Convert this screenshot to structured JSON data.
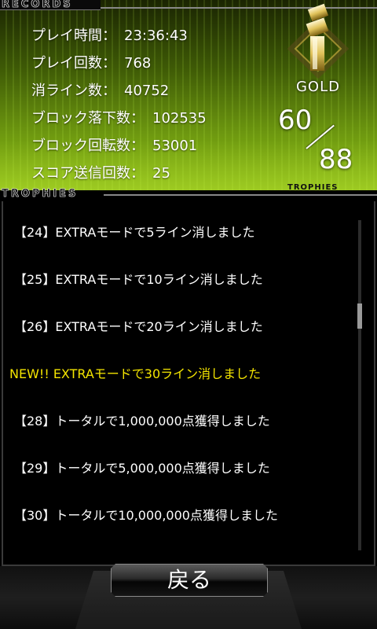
{
  "records": {
    "section_title": "RECORDS",
    "stats": [
      {
        "label": "プレイ時間：",
        "value": "23:36:43"
      },
      {
        "label": "プレイ回数：",
        "value": "768"
      },
      {
        "label": "消ライン数：",
        "value": "40752"
      },
      {
        "label": "ブロック落下数：",
        "value": "102535"
      },
      {
        "label": "ブロック回転数：",
        "value": "53001"
      },
      {
        "label": "スコア送信回数：",
        "value": "25"
      }
    ]
  },
  "rank": {
    "label": "GOLD",
    "badge_icon": "gold-rank-emblem-icon",
    "trophies_earned": "60",
    "trophies_total": "88",
    "caption": "TROPHIES"
  },
  "trophies": {
    "section_title": "TROPHIES",
    "items": [
      {
        "text": "【24】EXTRAモードで5ライン消しました",
        "is_new": false
      },
      {
        "text": "【25】EXTRAモードで10ライン消しました",
        "is_new": false
      },
      {
        "text": "【26】EXTRAモードで20ライン消しました",
        "is_new": false
      },
      {
        "text": "NEW!! EXTRAモードで30ライン消しました",
        "is_new": true
      },
      {
        "text": "【28】トータルで1,000,000点獲得しました",
        "is_new": false
      },
      {
        "text": "【29】トータルで5,000,000点獲得しました",
        "is_new": false
      },
      {
        "text": "【30】トータルで10,000,000点獲得しました",
        "is_new": false
      }
    ]
  },
  "footer": {
    "back_label": "戻る"
  },
  "colors": {
    "accent_green": "#8cbc16",
    "new_highlight": "#f4e500",
    "badge_gold": "#c8a640"
  }
}
